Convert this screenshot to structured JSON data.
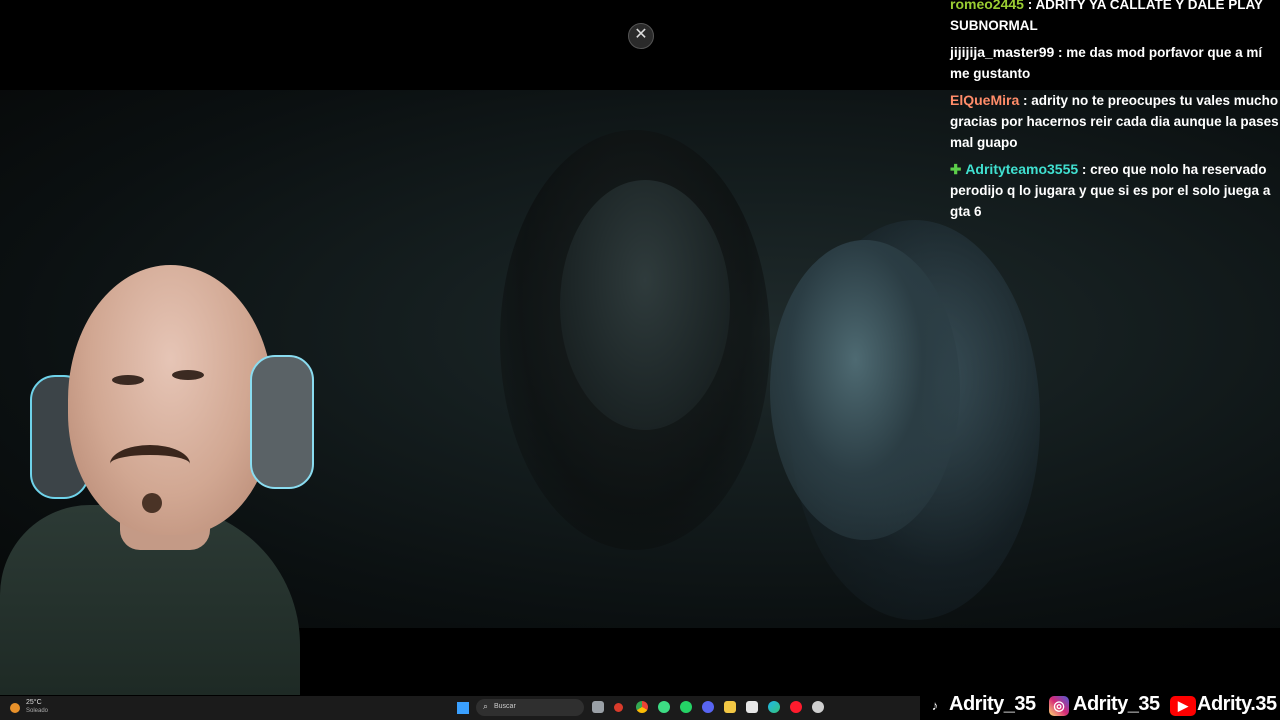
{
  "close_button": {
    "symbol": "✕"
  },
  "chat": {
    "messages": [
      {
        "user": "romeo2445",
        "user_color": "#9acd32",
        "separator": " : ",
        "text": "ADRITY YA CALLATE Y DALE PLAY SUBNORMAL"
      },
      {
        "user": "jijijija_master99",
        "user_color": "#ffffff",
        "separator": " : ",
        "text": "me das mod porfavor que a mí me gustanto"
      },
      {
        "user": "ElQueMira",
        "user_color": "#ff8c69",
        "separator": " : ",
        "text": "adrity no te preocupes tu vales mucho gracias por hacernos reir cada dia aunque la pases mal guapo"
      },
      {
        "user": "Adrityteamo3555",
        "user_color": "#40e0d0",
        "badge": "✚",
        "separator": " : ",
        "text": "creo que nolo ha reservado perodijo q lo jugara y que si es por el solo juega a gta 6"
      }
    ]
  },
  "taskbar": {
    "weather_temp": "25°C",
    "weather_condition": "Soleado",
    "search_placeholder": "Buscar",
    "search_icon": "⌕"
  },
  "socials": [
    {
      "platform": "tiktok",
      "handle": "Adrity_35",
      "icon": "♪",
      "color": "#000000"
    },
    {
      "platform": "instagram",
      "handle": "Adrity_35",
      "icon": "◎",
      "color": "#d6249f"
    },
    {
      "platform": "youtube",
      "handle": "Adrity.35",
      "icon": "▶",
      "color": "#ff0000"
    }
  ]
}
